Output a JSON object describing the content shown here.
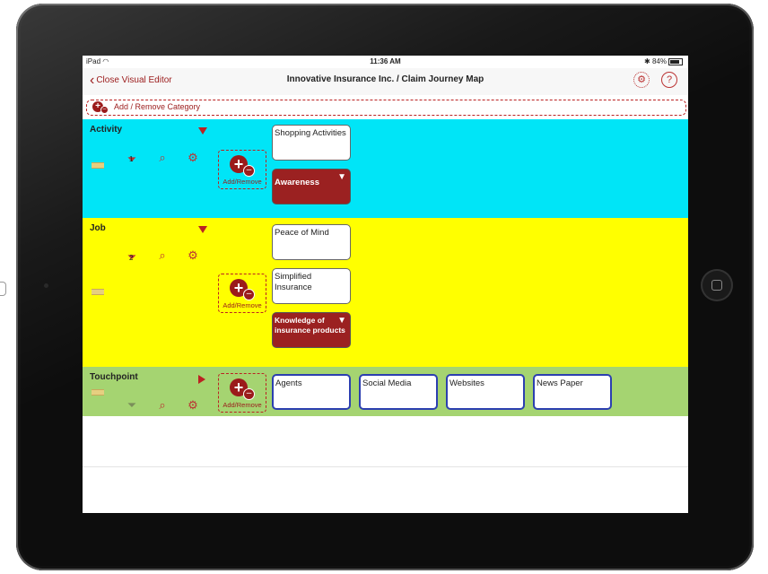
{
  "status_bar": {
    "carrier": "iPad",
    "time": "11:36 AM",
    "battery": "84%"
  },
  "nav": {
    "back_label": "Close Visual Editor",
    "title": "Innovative Insurance Inc. / Claim Journey Map"
  },
  "category_bar": {
    "label": "Add / Remove Category"
  },
  "add_remove_label": "Add/Remove",
  "bands": [
    {
      "title": "Activity",
      "color": "#00e5f7",
      "filter_count": "1",
      "cards": [
        {
          "label": "Shopping Activities",
          "style": "white"
        },
        {
          "label": "Awareness",
          "style": "red"
        }
      ]
    },
    {
      "title": "Job",
      "color": "#ffff00",
      "filter_count": "2",
      "cards": [
        {
          "label": "Peace of Mind",
          "style": "white"
        },
        {
          "label": "Simplified Insurance",
          "style": "white"
        },
        {
          "label": "Knowledge of insurance products",
          "style": "red"
        }
      ]
    },
    {
      "title": "Touchpoint",
      "color": "#a5d471",
      "cards": [
        {
          "label": "Agents",
          "style": "blue"
        },
        {
          "label": "Social Media",
          "style": "blue"
        },
        {
          "label": "Websites",
          "style": "blue"
        },
        {
          "label": "News Paper",
          "style": "blue"
        }
      ]
    }
  ],
  "icons": [
    "wifi-icon",
    "bluetooth-icon",
    "battery-icon",
    "chevron-left-icon",
    "gear-icon",
    "help-icon",
    "add-remove-icon",
    "filter-icon",
    "search-icon",
    "settings-gears-icon",
    "drag-handle-icon",
    "collapse-triangle-icon",
    "expand-triangle-icon"
  ]
}
